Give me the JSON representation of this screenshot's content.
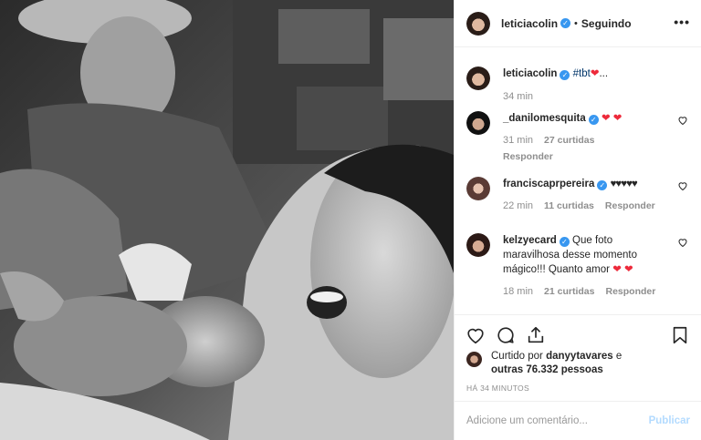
{
  "post": {
    "author": "leticiacolin",
    "follow_status": "Seguindo",
    "separator": "•",
    "more_icon": "more-icon"
  },
  "caption": {
    "user": "leticiacolin",
    "text": "#tbt",
    "emoji": "❤",
    "ellipsis": "...",
    "time": "34 min"
  },
  "comments": [
    {
      "user": "_danilomesquita",
      "text": "",
      "emoji": "❤ ❤",
      "time": "31 min",
      "likes": "27 curtidas",
      "reply": "Responder"
    },
    {
      "user": "franciscaprpereira",
      "text": "",
      "emoji": "♥♥♥♥♥",
      "time": "22 min",
      "likes": "11 curtidas",
      "reply": "Responder"
    },
    {
      "user": "kelzyecard",
      "text": "Que foto maravilhosa desse momento mágico!!! Quanto amor",
      "emoji": "❤ ❤",
      "time": "18 min",
      "likes": "21 curtidas",
      "reply": "Responder"
    }
  ],
  "likes_line": {
    "prefix": "Curtido por",
    "user": "danyytavares",
    "middle": "e",
    "others": "outras 76.332 pessoas"
  },
  "timestamp": "HÁ 34 MINUTOS",
  "add_comment": {
    "placeholder": "Adicione um comentário...",
    "post_label": "Publicar"
  },
  "colors": {
    "verified": "#3897f0",
    "heart": "#ed2a3b",
    "muted": "#8e8e8e",
    "publish_disabled": "#b3dbff"
  }
}
